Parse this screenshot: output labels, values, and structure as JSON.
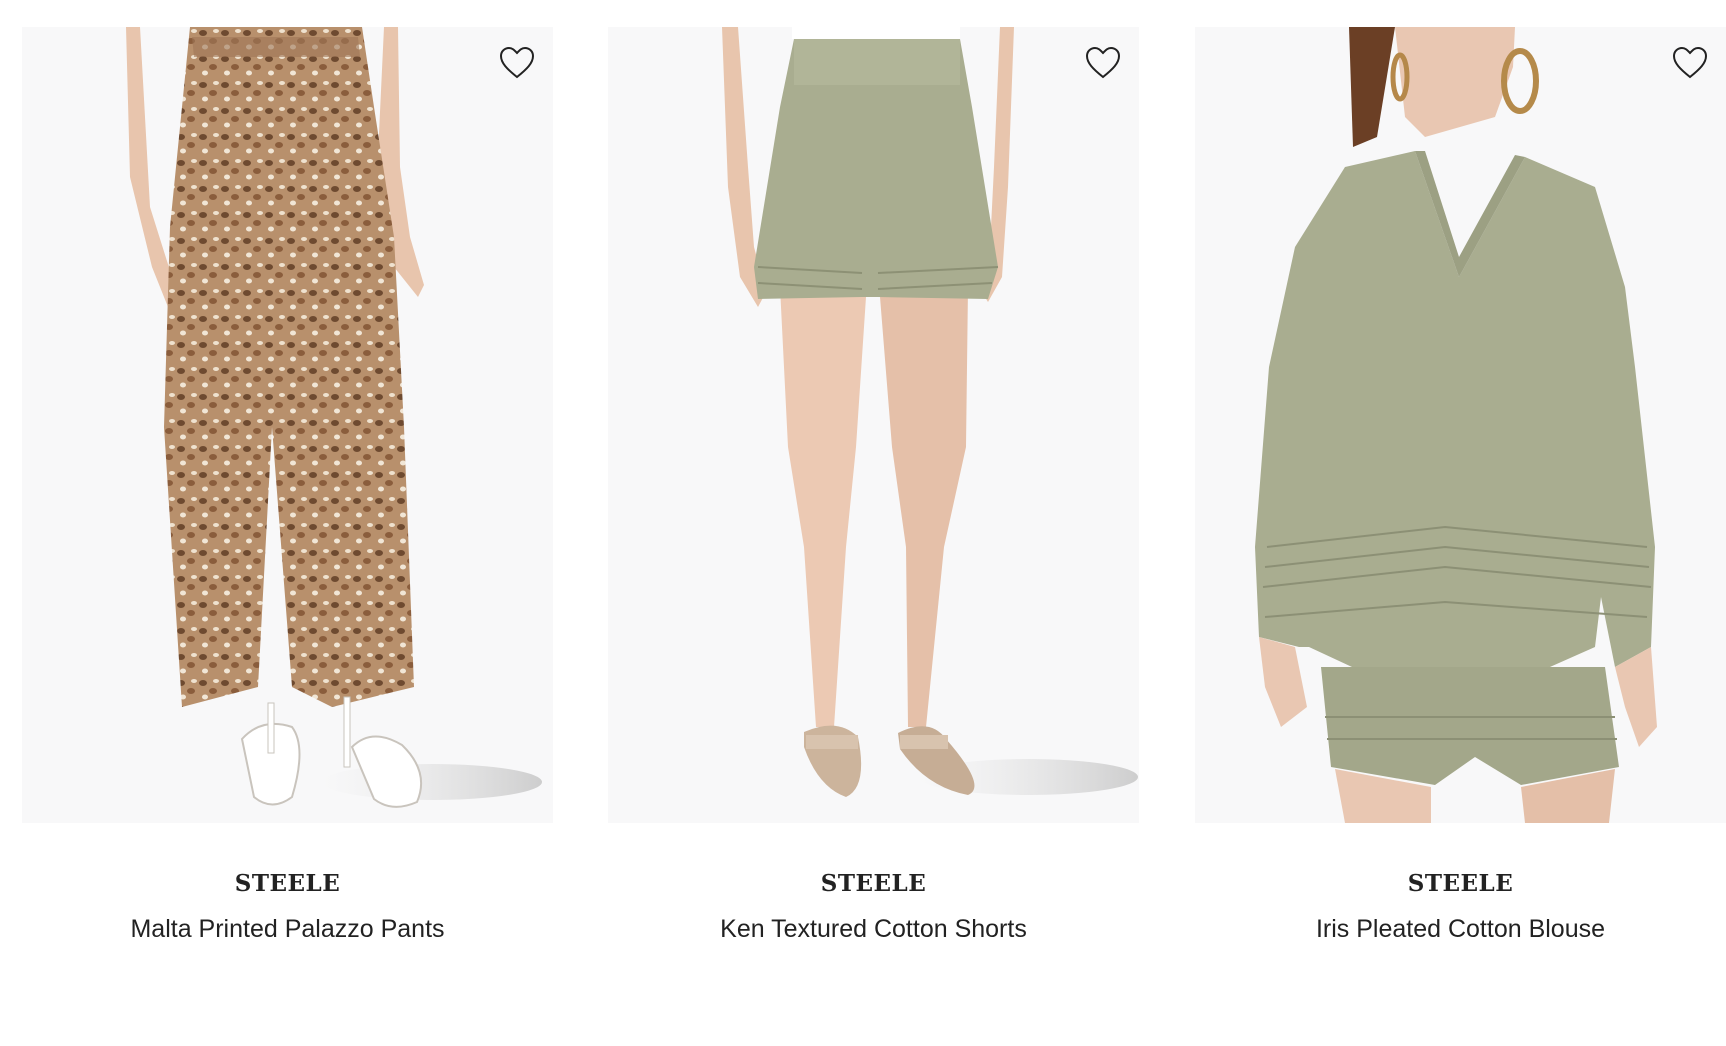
{
  "products": [
    {
      "brand": "STEELE",
      "name": "Malta Printed Palazzo Pants",
      "icon": "heart-outline-icon"
    },
    {
      "brand": "STEELE",
      "name": "Ken Textured Cotton Shorts",
      "icon": "heart-outline-icon"
    },
    {
      "brand": "STEELE",
      "name": "Iris Pleated Cotton Blouse",
      "icon": "heart-outline-icon"
    }
  ],
  "colors": {
    "image_bg": "#f8f8f9",
    "text": "#222222",
    "khaki": "#a9ad90",
    "skin": "#e9c7b2",
    "print_brown": "#a77a58"
  }
}
